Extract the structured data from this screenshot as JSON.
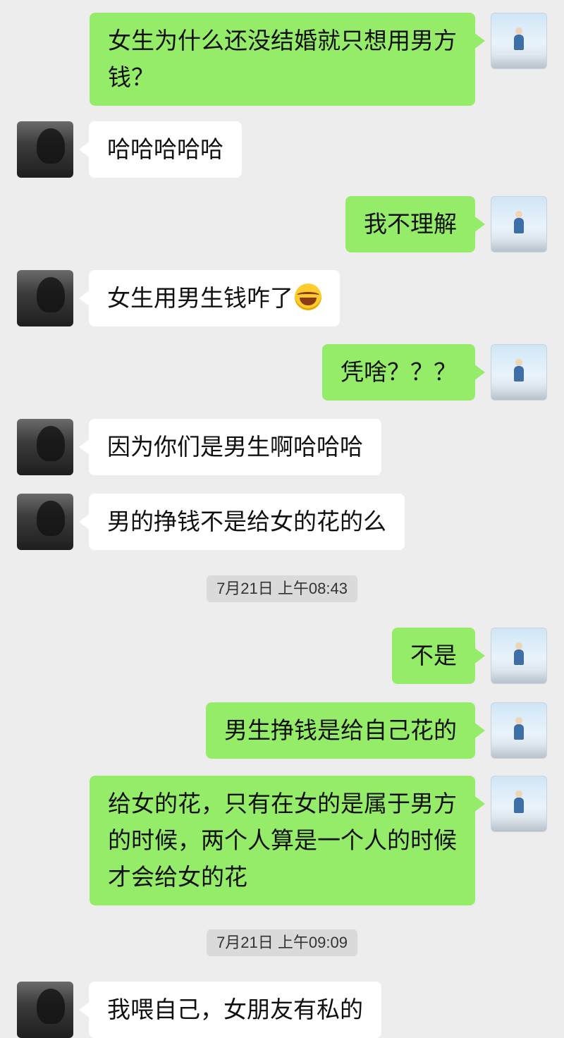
{
  "colors": {
    "background": "#ededed",
    "my_bubble": "#95ec69",
    "their_bubble": "#ffffff"
  },
  "messages": [
    {
      "side": "me",
      "text": "女生为什么还没结婚就只想用男方\n钱？"
    },
    {
      "side": "other",
      "text": "哈哈哈哈哈"
    },
    {
      "side": "me",
      "text": "我不理解"
    },
    {
      "side": "other",
      "text": "女生用男生钱咋了",
      "emoji": "laughing-tears-emoji"
    },
    {
      "side": "me",
      "text": "凭啥？？？"
    },
    {
      "side": "other",
      "text": "因为你们是男生啊哈哈哈"
    },
    {
      "side": "other",
      "text": "男的挣钱不是给女的花的么"
    },
    {
      "side": "me",
      "text": "不是"
    },
    {
      "side": "me",
      "text": "男生挣钱是给自己花的"
    },
    {
      "side": "me",
      "text": "给女的花，只有在女的是属于男方\n的时候，两个人算是一个人的时候\n才会给女的花"
    },
    {
      "side": "other",
      "text": "我喂自己，女朋友有私的"
    }
  ],
  "timestamps": [
    {
      "text": "7月21日 上午08:43"
    },
    {
      "text": "7月21日 上午09:09"
    }
  ]
}
